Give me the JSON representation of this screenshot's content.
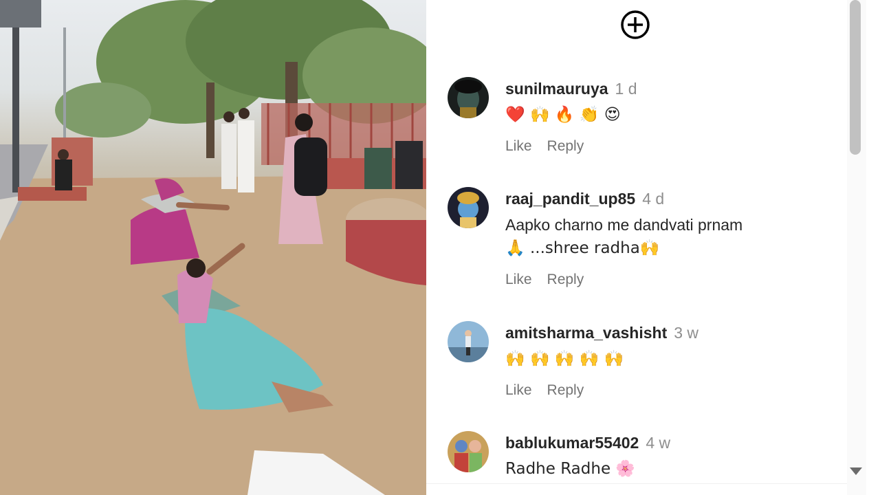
{
  "comments": [
    {
      "username": "sunilmauruya",
      "time": "1 d",
      "text": "❤️ 🙌 🔥 👏 😍",
      "like": "Like",
      "reply": "Reply"
    },
    {
      "username": "raaj_pandit_up85",
      "time": "4 d",
      "text": "Aapko charno me dandvati prnam",
      "text2": "🙏 ...shree radha🙌",
      "like": "Like",
      "reply": "Reply"
    },
    {
      "username": "amitsharma_vashisht",
      "time": "3 w",
      "text": "🙌 🙌 🙌 🙌 🙌",
      "like": "Like",
      "reply": "Reply"
    },
    {
      "username": "bablukumar55402",
      "time": "4 w",
      "text": "Radhe Radhe 🌸"
    }
  ],
  "icons": {
    "add": "plus-circle-icon",
    "scroll_down": "chevron-down-icon"
  },
  "colors": {
    "username": "#262626",
    "meta": "#8e8e8e",
    "actions": "#737373"
  }
}
